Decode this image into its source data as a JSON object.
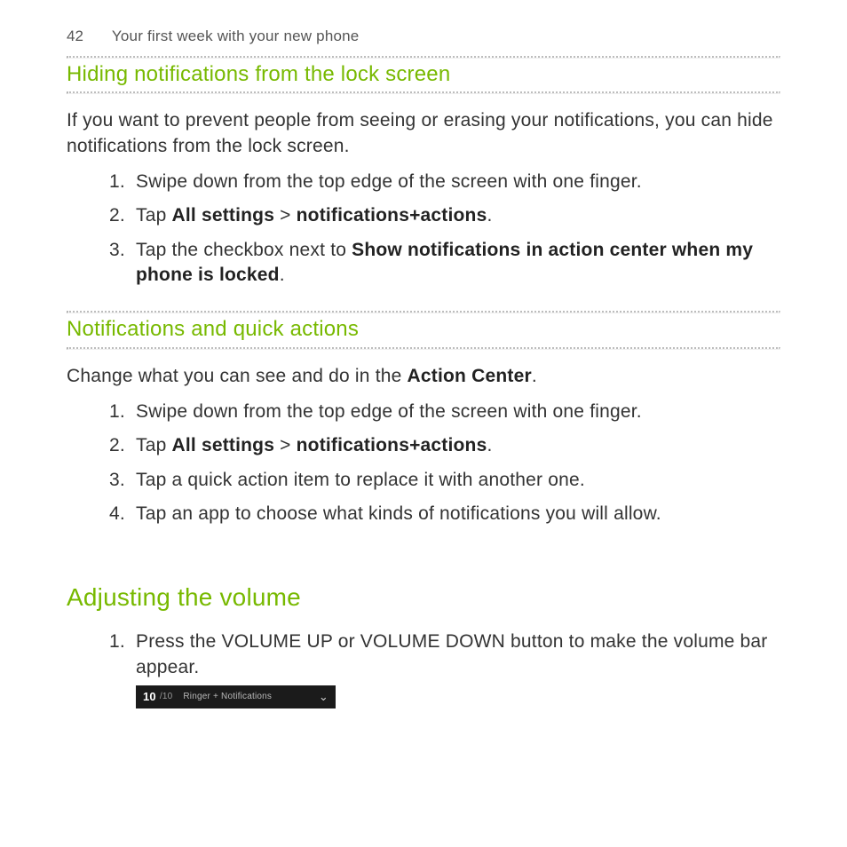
{
  "header": {
    "page_number": "42",
    "section": "Your first week with your new phone"
  },
  "sec1": {
    "title": "Hiding notifications from the lock screen",
    "intro": "If you want to prevent people from seeing or erasing your notifications, you can hide notifications from the lock screen.",
    "steps": {
      "s1": "Swipe down from the top edge of the screen with one finger.",
      "s2_pre": "Tap ",
      "s2_b1": "All settings",
      "s2_mid": " > ",
      "s2_b2": "notifications+actions",
      "s2_post": ".",
      "s3_pre": "Tap the checkbox next to ",
      "s3_b": "Show notifications in action center when my phone is locked",
      "s3_post": "."
    }
  },
  "sec2": {
    "title": "Notifications and quick actions",
    "intro_pre": "Change what you can see and do in the ",
    "intro_b": "Action Center",
    "intro_post": ".",
    "steps": {
      "s1": "Swipe down from the top edge of the screen with one finger.",
      "s2_pre": "Tap ",
      "s2_b1": "All settings",
      "s2_mid": " > ",
      "s2_b2": "notifications+actions",
      "s2_post": ".",
      "s3": "Tap a quick action item to replace it with another one.",
      "s4": "Tap an app to choose what kinds of notifications you will allow."
    }
  },
  "sec3": {
    "title": "Adjusting the volume",
    "steps": {
      "s1": "Press the VOLUME UP or VOLUME DOWN button to make the volume bar appear."
    },
    "volume_bar": {
      "level": "10",
      "max": "/10",
      "label": "Ringer + Notifications"
    }
  }
}
